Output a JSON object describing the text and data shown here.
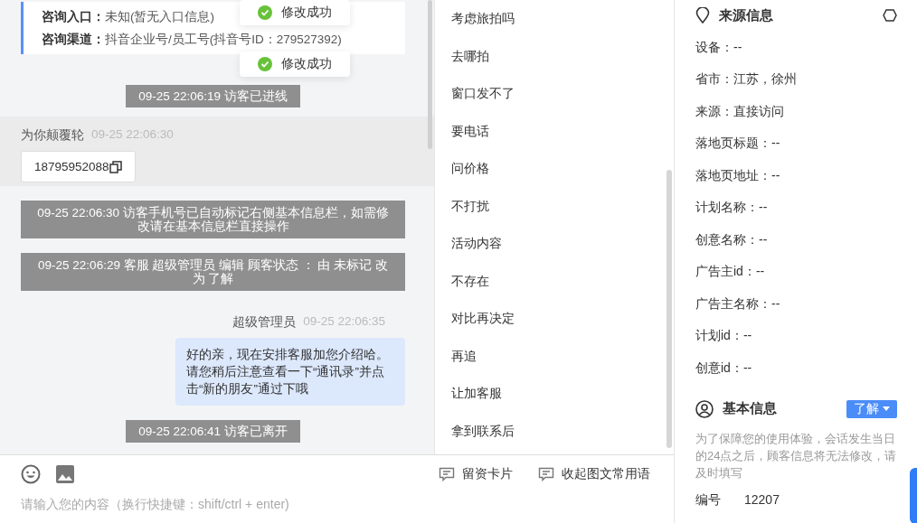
{
  "toasts": [
    {
      "text": "修改成功"
    },
    {
      "text": "修改成功"
    }
  ],
  "chat": {
    "info_card": [
      {
        "label": "咨询入口：",
        "value": "未知(暂无入口信息)"
      },
      {
        "label": "咨询渠道：",
        "value": "抖音企业号/员工号(抖音号ID：279527392)"
      }
    ],
    "messages": [
      {
        "kind": "system",
        "text": "09-25 22:06:19 访客已进线"
      },
      {
        "kind": "visitor",
        "sender": "为你颠覆轮",
        "time": "09-25 22:06:30",
        "text": "18795952088"
      },
      {
        "kind": "system",
        "text": "09-25 22:06:30 访客手机号已自动标记右侧基本信息栏，如需修改请在基本信息栏直接操作"
      },
      {
        "kind": "system",
        "text": "09-25 22:06:29 客服 超级管理员 编辑 顾客状态 ： 由 未标记 改为 了解"
      },
      {
        "kind": "agent",
        "sender": "超级管理员",
        "time": "09-25 22:06:35",
        "text": "好的亲，现在安排客服加您介绍哈。请您稍后注意查看一下“通讯录”并点击“新的朋友”通过下哦"
      },
      {
        "kind": "system",
        "text": "09-25 22:06:41 访客已离开"
      }
    ]
  },
  "quick_replies": [
    "考虑旅拍吗",
    "去哪拍",
    "窗口发不了",
    "要电话",
    "问价格",
    "不打扰",
    "活动内容",
    "不存在",
    "对比再决定",
    "再追",
    "让加客服",
    "拿到联系后"
  ],
  "composer": {
    "buttons": [
      "留资卡片",
      "收起图文常用语"
    ],
    "placeholder": "请输入您的内容（换行快捷键：shift/ctrl + enter)"
  },
  "source_info": {
    "title": "来源信息",
    "lines": [
      "设备：--",
      "省市：江苏，徐州",
      "来源：直接访问",
      "落地页标题：--",
      "落地页地址：--",
      "计划名称：--",
      "创意名称：--",
      "广告主id：--",
      "广告主名称：--",
      "计划id：--",
      "创意id：--"
    ]
  },
  "basic_info": {
    "title": "基本信息",
    "status": "了解",
    "notice": "为了保障您的使用体验，会话发生当日的24点之后，顾客信息将无法修改，请及时填写",
    "fields": [
      {
        "label": "编号",
        "value": "12207"
      }
    ]
  }
}
